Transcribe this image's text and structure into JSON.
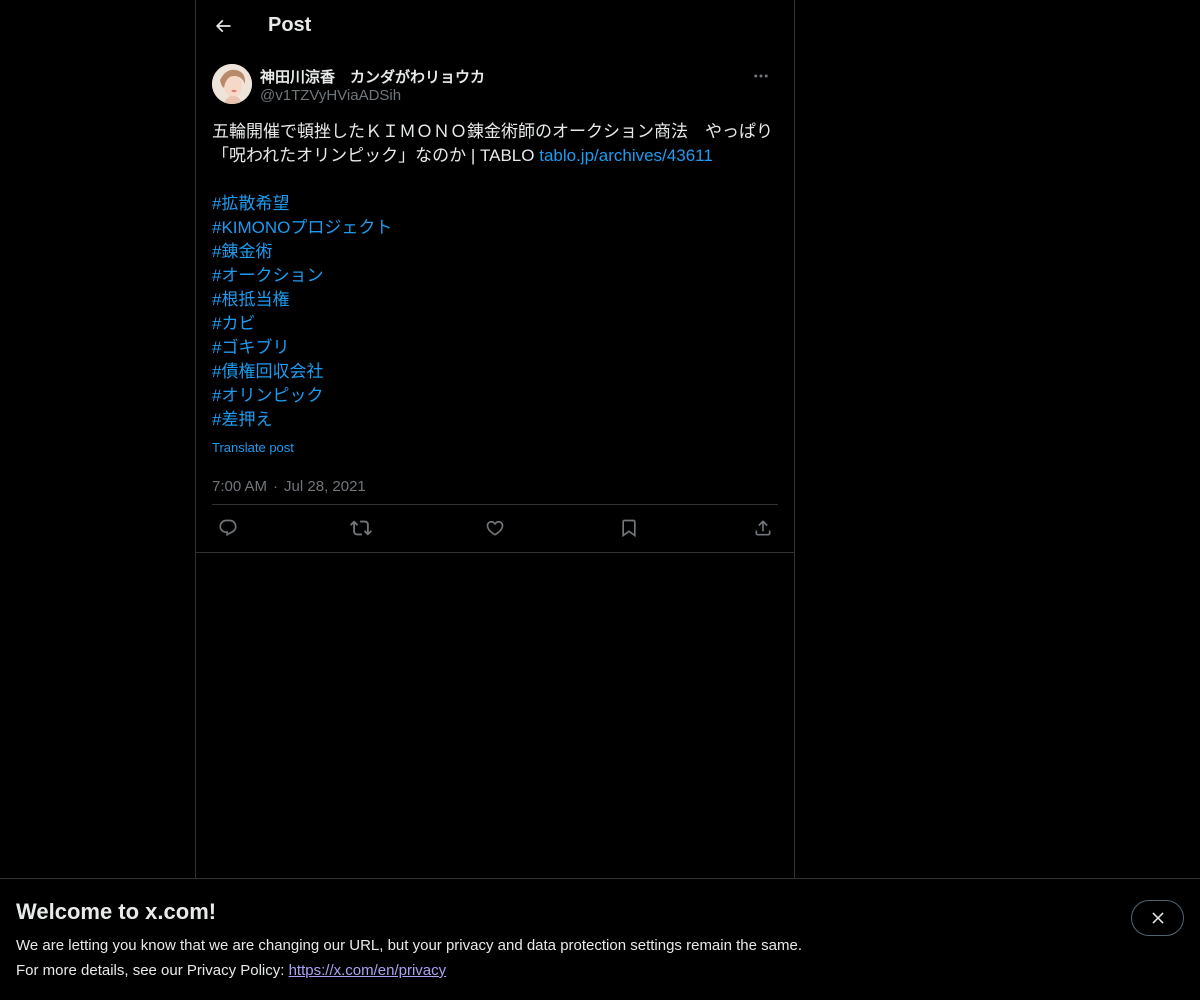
{
  "header": {
    "title": "Post"
  },
  "post": {
    "author_name": "神田川涼香　カンダがわリョウカ",
    "author_handle": "@v1TZVyHViaADSih",
    "text_line1": "五輪開催で頓挫したＫＩＭＯＮＯ錬金術師のオークション商法　やっぱり",
    "text_line2_prefix": "「呪われたオリンピック」なのか | TABLO ",
    "link_text": "tablo.jp/archives/43611",
    "hashtags": [
      "#拡散希望",
      "#KIMONOプロジェクト",
      "#錬金術",
      "#オークション",
      "#根抵当権",
      "#カビ",
      "#ゴキブリ",
      "#債権回収会社",
      "#オリンピック",
      "#差押え"
    ],
    "translate_label": "Translate post",
    "time": "7:00 AM",
    "separator": "·",
    "date": "Jul 28, 2021"
  },
  "actions": {
    "icons": [
      "reply-icon",
      "repost-icon",
      "like-icon",
      "bookmark-icon",
      "share-icon"
    ]
  },
  "banner": {
    "title": "Welcome to x.com!",
    "line1": "We are letting you know that we are changing our URL, but your privacy and data protection settings remain the same.",
    "line2_prefix": "For more details, see our Privacy Policy: ",
    "link": "https://x.com/en/privacy"
  },
  "colors": {
    "background": "#000000",
    "text": "#e7e9ea",
    "muted": "#71767b",
    "link": "#1d9bf0",
    "border": "#2f3336"
  }
}
